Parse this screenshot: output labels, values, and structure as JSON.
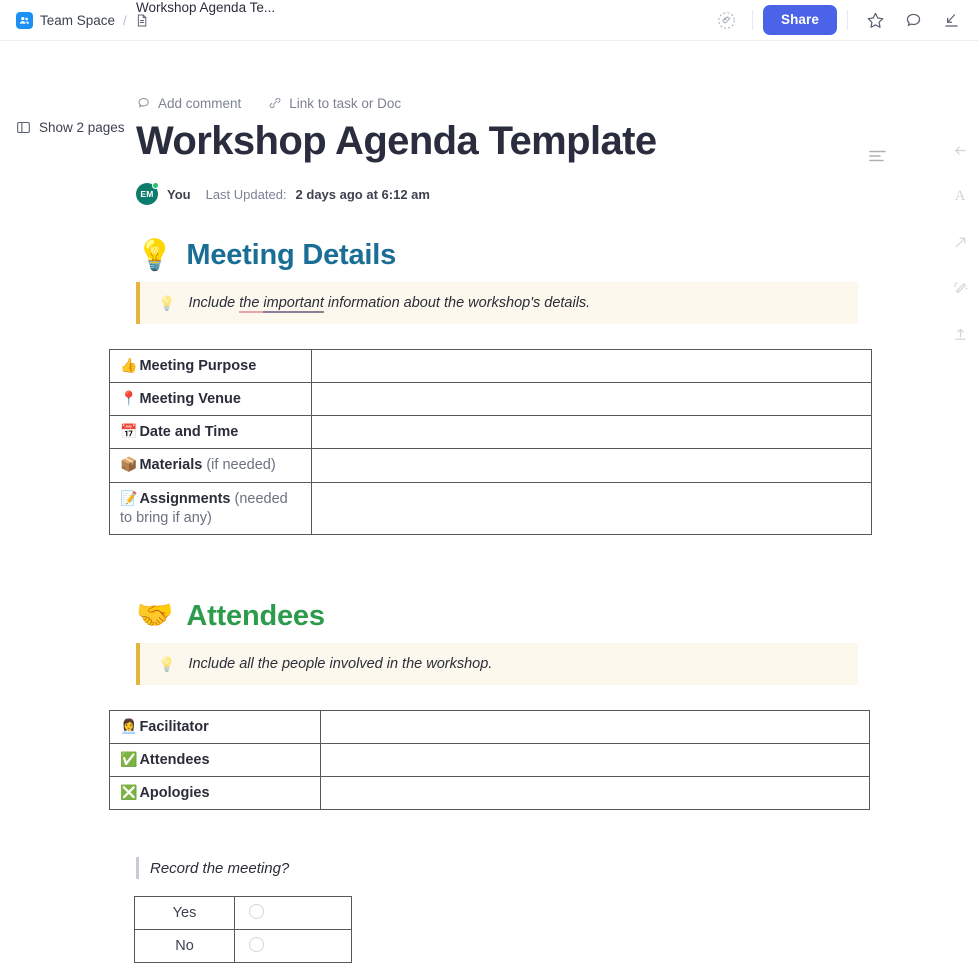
{
  "topbar": {
    "breadcrumb": {
      "space_label": "Team Space",
      "separator": "/",
      "doc_label": "Workshop Agenda Te..."
    },
    "tag_icon": "tag-icon",
    "share_label": "Share",
    "star_icon": "star-icon",
    "comment_icon": "comment-bubble-icon",
    "collapse_icon": "collapse-down-right-icon",
    "accent_color": "#4a63e7"
  },
  "left_gutter": {
    "show_pages_label": "Show 2 pages",
    "panel_icon": "side-panel-icon"
  },
  "right_rail": {
    "items": [
      {
        "name": "arrow-left-icon",
        "glyph": "←"
      },
      {
        "name": "font-size-icon",
        "glyph": "A"
      },
      {
        "name": "expand-arrow-icon",
        "glyph": "↗"
      },
      {
        "name": "magic-wand-icon",
        "glyph": "✦"
      },
      {
        "name": "upload-icon",
        "glyph": "⇧"
      }
    ]
  },
  "doc": {
    "actions": [
      {
        "icon": "comment-bubble-icon",
        "label": "Add comment"
      },
      {
        "icon": "link-icon",
        "label": "Link to task or Doc"
      }
    ],
    "title": "Workshop Agenda Template",
    "align_icon": "align-left-icon",
    "meta": {
      "avatar_initials": "EM",
      "avatar_color": "#0c7c6d",
      "presence_color": "#25c16f",
      "author": "You",
      "updated_label": "Last Updated:",
      "updated_value": "2 days ago at 6:12 am"
    }
  },
  "sections": [
    {
      "emoji": "💡",
      "emoji_name": "light-bulb-emoji",
      "title": "Meeting Details",
      "title_color": "#1a6e95",
      "callout": {
        "bulb": "💡",
        "text_before": "Include ",
        "text_underline_pink": "the ",
        "text_underline_purple": "important",
        "text_after": " information about the workshop's details."
      },
      "table": {
        "rows": [
          {
            "emoji": "👍",
            "emoji_name": "thumbs-up-emoji",
            "label": "Meeting Purpose",
            "note": "",
            "value": ""
          },
          {
            "emoji": "📍",
            "emoji_name": "pin-emoji",
            "label": "Meeting Venue",
            "note": "",
            "value": ""
          },
          {
            "emoji": "📅",
            "emoji_name": "calendar-emoji",
            "label": "Date and Time",
            "note": "",
            "value": ""
          },
          {
            "emoji": "📦",
            "emoji_name": "package-emoji",
            "label": "Materials",
            "note": " (if needed)",
            "value": ""
          },
          {
            "emoji": "📝",
            "emoji_name": "memo-emoji",
            "label": "Assignments",
            "note": " (needed to bring if any)",
            "value": ""
          }
        ]
      }
    },
    {
      "emoji": "🤝",
      "emoji_name": "handshake-emoji",
      "title": "Attendees",
      "title_color": "#2d9b4c",
      "callout": {
        "bulb": "💡",
        "text_before": "Include all the people involved in the workshop.",
        "text_underline_pink": "",
        "text_underline_purple": "",
        "text_after": ""
      },
      "table": {
        "rows": [
          {
            "emoji": "👩‍💼",
            "emoji_name": "facilitator-emoji",
            "label": "Facilitator",
            "note": "",
            "value": ""
          },
          {
            "emoji": "✅",
            "emoji_name": "check-mark-button-emoji",
            "label": "Attendees",
            "note": "",
            "value": ""
          },
          {
            "emoji": "❎",
            "emoji_name": "cross-mark-button-emoji",
            "label": "Apologies",
            "note": "",
            "value": ""
          }
        ]
      }
    }
  ],
  "record": {
    "question": "Record the meeting?",
    "options": [
      {
        "label": "Yes",
        "selected": false
      },
      {
        "label": "No",
        "selected": false
      }
    ]
  }
}
